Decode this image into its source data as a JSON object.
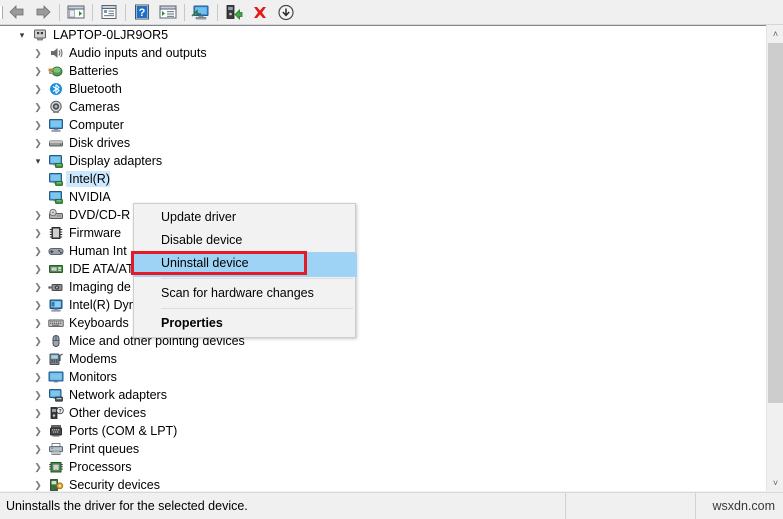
{
  "toolbar": {
    "items": [
      {
        "name": "back-arrow-icon",
        "label": "Back",
        "enabled": false
      },
      {
        "name": "forward-arrow-icon",
        "label": "Forward",
        "enabled": false
      },
      {
        "name": "separator-1",
        "label": "",
        "enabled": false
      },
      {
        "name": "show-hide-console-tree-icon",
        "label": "Show/Hide Console Tree",
        "enabled": true
      },
      {
        "name": "separator-2",
        "label": "",
        "enabled": false
      },
      {
        "name": "properties-icon",
        "label": "Properties",
        "enabled": true
      },
      {
        "name": "separator-3",
        "label": "",
        "enabled": false
      },
      {
        "name": "help-icon",
        "label": "Help",
        "enabled": true
      },
      {
        "name": "action-list-icon",
        "label": "Action",
        "enabled": true
      },
      {
        "name": "separator-4",
        "label": "",
        "enabled": false
      },
      {
        "name": "scan-hardware-changes-icon",
        "label": "Scan for hardware changes",
        "enabled": true
      },
      {
        "name": "separator-5",
        "label": "",
        "enabled": false
      },
      {
        "name": "update-driver-icon",
        "label": "Update driver",
        "enabled": true
      },
      {
        "name": "uninstall-device-icon",
        "label": "Uninstall device",
        "enabled": true
      },
      {
        "name": "disable-device-icon",
        "label": "Disable device",
        "enabled": true
      }
    ]
  },
  "tree": {
    "root": {
      "label": "LAPTOP-0LJR9OR5",
      "icon": "computer-icon",
      "expanded": true
    },
    "items": [
      {
        "label": "Audio inputs and outputs",
        "icon": "speaker-icon",
        "depth": 1,
        "expanded": false
      },
      {
        "label": "Batteries",
        "icon": "battery-icon",
        "depth": 1,
        "expanded": false
      },
      {
        "label": "Bluetooth",
        "icon": "bluetooth-icon",
        "depth": 1,
        "expanded": false
      },
      {
        "label": "Cameras",
        "icon": "camera-icon",
        "depth": 1,
        "expanded": false
      },
      {
        "label": "Computer",
        "icon": "monitor-icon",
        "depth": 1,
        "expanded": false
      },
      {
        "label": "Disk drives",
        "icon": "disk-drive-icon",
        "depth": 1,
        "expanded": false
      },
      {
        "label": "Display adapters",
        "icon": "display-adapter-icon",
        "depth": 1,
        "expanded": true
      },
      {
        "label": "Intel(R)",
        "icon": "display-adapter-icon",
        "depth": 2,
        "expanded": false,
        "selected": true
      },
      {
        "label": "NVIDIA",
        "icon": "display-adapter-icon",
        "depth": 2,
        "expanded": false
      },
      {
        "label": "DVD/CD-R",
        "icon": "dvd-drive-icon",
        "depth": 1,
        "expanded": false
      },
      {
        "label": "Firmware",
        "icon": "firmware-icon",
        "depth": 1,
        "expanded": false
      },
      {
        "label": "Human Int",
        "icon": "hid-icon",
        "depth": 1,
        "expanded": false
      },
      {
        "label": "IDE ATA/AT",
        "icon": "ide-controller-icon",
        "depth": 1,
        "expanded": false
      },
      {
        "label": "Imaging de",
        "icon": "imaging-device-icon",
        "depth": 1,
        "expanded": false
      },
      {
        "label": "Intel(R) Dynamic Platform and Thermal Framework",
        "icon": "system-device-icon",
        "depth": 1,
        "expanded": false
      },
      {
        "label": "Keyboards",
        "icon": "keyboard-icon",
        "depth": 1,
        "expanded": false
      },
      {
        "label": "Mice and other pointing devices",
        "icon": "mouse-icon",
        "depth": 1,
        "expanded": false
      },
      {
        "label": "Modems",
        "icon": "modem-icon",
        "depth": 1,
        "expanded": false
      },
      {
        "label": "Monitors",
        "icon": "monitor-icon",
        "depth": 1,
        "expanded": false
      },
      {
        "label": "Network adapters",
        "icon": "network-adapter-icon",
        "depth": 1,
        "expanded": false
      },
      {
        "label": "Other devices",
        "icon": "other-device-icon",
        "depth": 1,
        "expanded": false
      },
      {
        "label": "Ports (COM & LPT)",
        "icon": "port-icon",
        "depth": 1,
        "expanded": false
      },
      {
        "label": "Print queues",
        "icon": "printer-icon",
        "depth": 1,
        "expanded": false
      },
      {
        "label": "Processors",
        "icon": "processor-icon",
        "depth": 1,
        "expanded": false
      },
      {
        "label": "Security devices",
        "icon": "security-device-icon",
        "depth": 1,
        "expanded": false
      }
    ]
  },
  "context_menu": {
    "items": [
      {
        "label": "Update driver",
        "type": "item",
        "highlighted": false,
        "bold": false
      },
      {
        "label": "Disable device",
        "type": "item",
        "highlighted": false,
        "bold": false
      },
      {
        "label": "Uninstall device",
        "type": "item",
        "highlighted": true,
        "bold": false
      },
      {
        "label": "",
        "type": "separator"
      },
      {
        "label": "Scan for hardware changes",
        "type": "item",
        "highlighted": false,
        "bold": false
      },
      {
        "label": "",
        "type": "separator"
      },
      {
        "label": "Properties",
        "type": "item",
        "highlighted": false,
        "bold": true
      }
    ]
  },
  "annotation": {
    "highlight_color": "#e21b26",
    "target_label": "Uninstall device"
  },
  "statusbar": {
    "message": "Uninstalls the driver for the selected device.",
    "middle": "",
    "watermark": "wsxdn.com"
  },
  "scrollbar": {
    "up_arrow": "˄",
    "down_arrow": "˅"
  },
  "colors": {
    "selection": "#cce8ff",
    "menu_highlight": "#9ed3f5",
    "annotation": "#e21b26",
    "chrome": "#f0f0f0"
  }
}
